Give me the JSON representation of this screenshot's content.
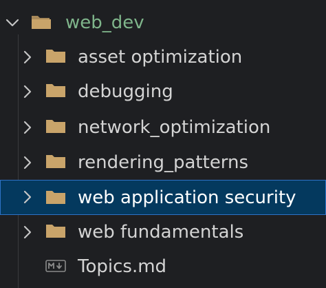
{
  "explorer": {
    "root": {
      "label": "web_dev",
      "expanded": true,
      "icon": "folder-open-icon",
      "color": "#7fb58b"
    },
    "items": [
      {
        "label": "asset optimization",
        "type": "folder",
        "icon": "folder-icon"
      },
      {
        "label": "debugging",
        "type": "folder",
        "icon": "folder-icon"
      },
      {
        "label": "network_optimization",
        "type": "folder",
        "icon": "folder-icon"
      },
      {
        "label": "rendering_patterns",
        "type": "folder",
        "icon": "folder-icon"
      },
      {
        "label": "web application security",
        "type": "folder",
        "icon": "folder-icon",
        "selected": true
      },
      {
        "label": "web fundamentals",
        "type": "folder",
        "icon": "folder-icon"
      },
      {
        "label": "Topics.md",
        "type": "file",
        "icon": "markdown-icon"
      }
    ]
  },
  "colors": {
    "background": "#1e1f22",
    "folder": "#c9a46a",
    "selection": "#04395e",
    "selection_border": "#2d73c7",
    "text": "#d4d4d4"
  }
}
